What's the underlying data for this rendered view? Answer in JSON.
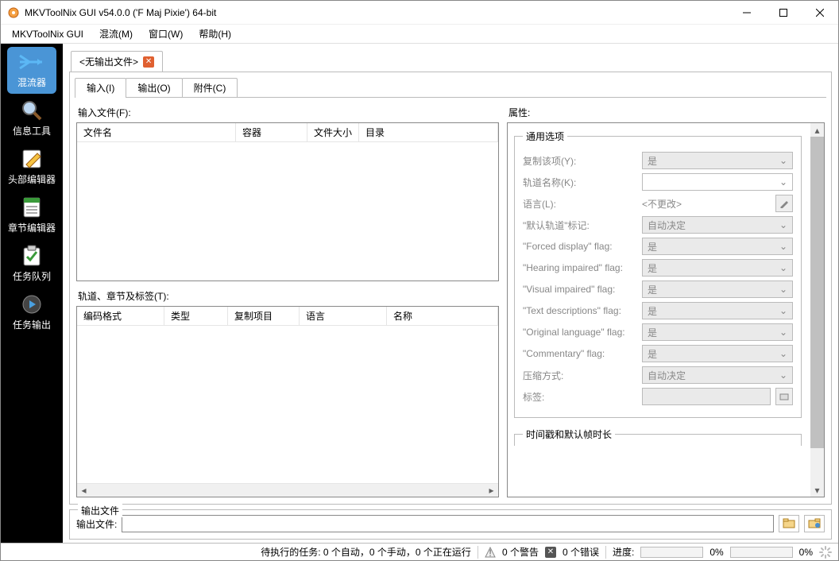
{
  "window": {
    "title": "MKVToolNix GUI v54.0.0 ('F Maj Pixie') 64-bit"
  },
  "menu": {
    "app": "MKVToolNix GUI",
    "mux": "混流(M)",
    "window": "窗口(W)",
    "help": "帮助(H)"
  },
  "sidebar": {
    "items": [
      {
        "label": "混流器"
      },
      {
        "label": "信息工具"
      },
      {
        "label": "头部编辑器"
      },
      {
        "label": "章节编辑器"
      },
      {
        "label": "任务队列"
      },
      {
        "label": "任务输出"
      }
    ]
  },
  "file_tab": {
    "label": "<无输出文件>"
  },
  "inner_tabs": {
    "input": "输入(I)",
    "output": "输出(O)",
    "attach": "附件(C)"
  },
  "input_files": {
    "label": "输入文件(F):",
    "cols": {
      "name": "文件名",
      "container": "容器",
      "size": "文件大小",
      "dir": "目录"
    }
  },
  "tracks": {
    "label": "轨道、章节及标签(T):",
    "cols": {
      "codec": "编码格式",
      "type": "类型",
      "copy": "复制项目",
      "lang": "语言",
      "name": "名称"
    }
  },
  "props": {
    "label": "属性:",
    "general_legend": "通用选项",
    "rows": {
      "copy_item": "复制该项(Y):",
      "track_name": "轨道名称(K):",
      "language": "语言(L):",
      "default_track": "\"默认轨道\"标记:",
      "forced_display": "\"Forced display\" flag:",
      "hearing": "\"Hearing impaired\" flag:",
      "visual": "\"Visual impaired\" flag:",
      "text_desc": "\"Text descriptions\" flag:",
      "orig_lang": "\"Original language\" flag:",
      "commentary": "\"Commentary\" flag:",
      "compression": "压缩方式:",
      "tags": "标签:"
    },
    "values": {
      "yes": "是",
      "auto": "自动决定",
      "nochange": "<不更改>"
    },
    "timing_legend": "时间戳和默认帧时长"
  },
  "output": {
    "legend": "输出文件",
    "label": "输出文件:"
  },
  "status": {
    "pending": "待执行的任务: 0 个自动，0 个手动，0 个正在运行",
    "warnings": "0 个警告",
    "errors": "0 个错误",
    "progress_label": "进度:",
    "pct": "0%"
  }
}
